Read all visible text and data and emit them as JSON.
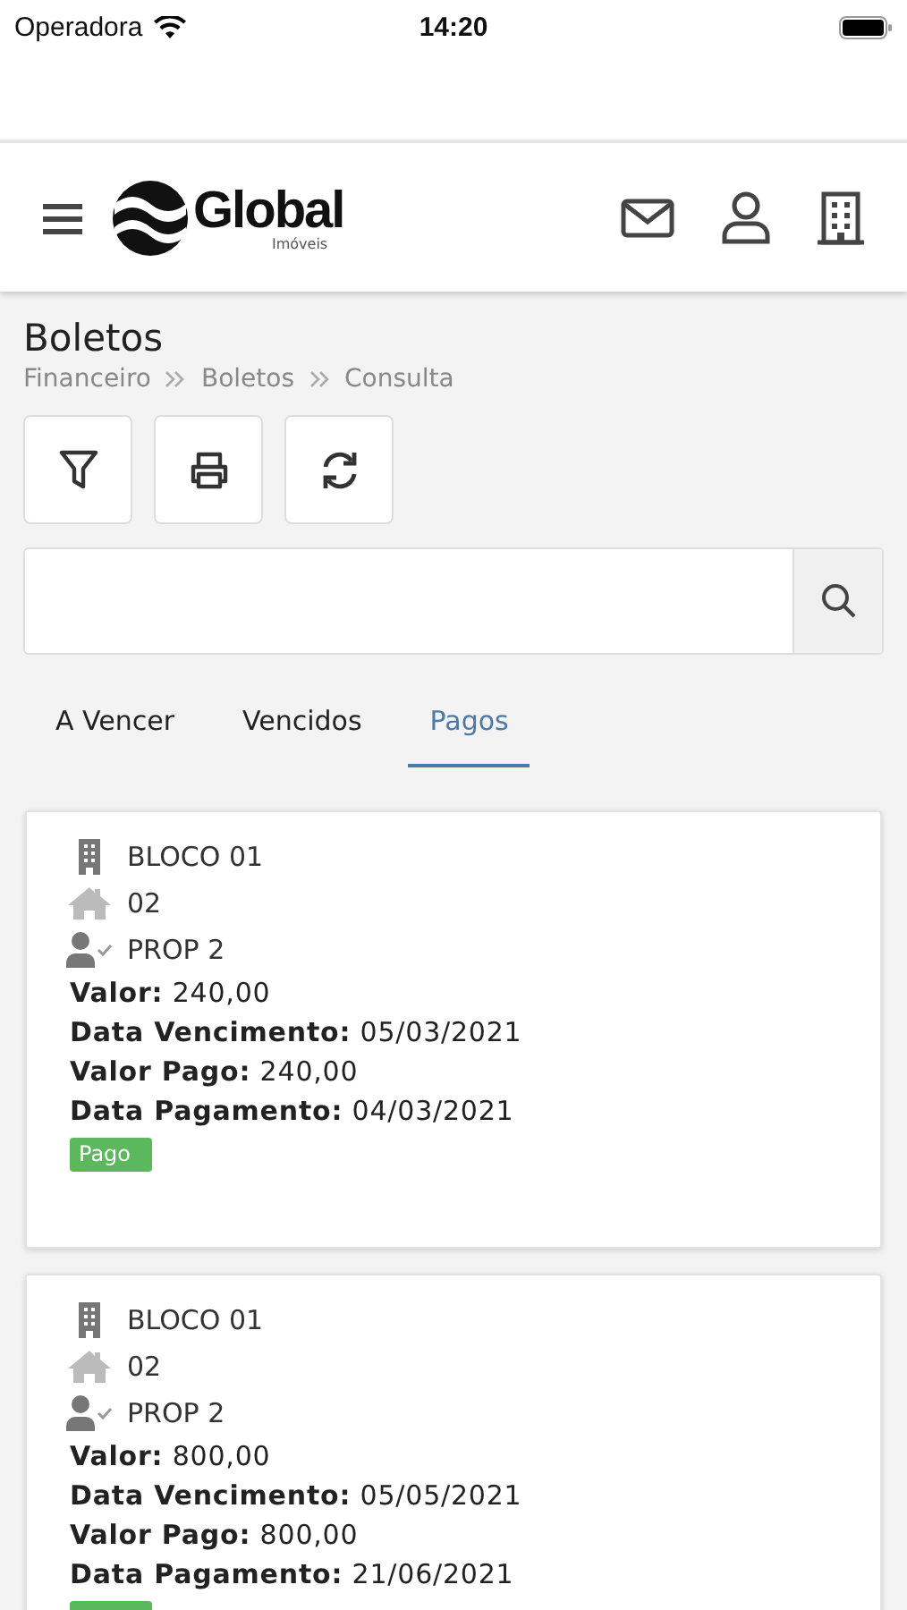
{
  "status_bar": {
    "carrier": "Operadora",
    "time": "14:20"
  },
  "header": {
    "logo": {
      "name": "Global",
      "subtitle": "Imóveis"
    }
  },
  "page": {
    "title": "Boletos",
    "breadcrumb": [
      "Financeiro",
      "Boletos",
      "Consulta"
    ]
  },
  "toolbar": [
    {
      "kind": "filter"
    },
    {
      "kind": "print"
    },
    {
      "kind": "refresh"
    }
  ],
  "tabs": [
    {
      "label": "A Vencer",
      "selected": false
    },
    {
      "label": "Vencidos",
      "selected": false
    },
    {
      "label": "Pagos",
      "selected": true
    }
  ],
  "cards": [
    {
      "block": "BLOCO 01",
      "unit": "02",
      "owner": "PROP 2",
      "details": [
        "**Valor:** 240,00",
        "**Data Vencimento:** 05/03/2021",
        "**Valor Pago:** 240,00",
        "**Data Pagamento:** 04/03/2021"
      ],
      "badge": {
        "label": "Pago",
        "color": "#5cb85c"
      }
    },
    {
      "block": "BLOCO 01",
      "unit": "02",
      "owner": "PROP 2",
      "details": [
        "**Valor:** 800,00",
        "**Data Vencimento:** 05/05/2021",
        "**Valor Pago:** 800,00",
        "**Data Pagamento:** 21/06/2021"
      ],
      "badge": {
        "color": "#5cb85c"
      }
    }
  ]
}
